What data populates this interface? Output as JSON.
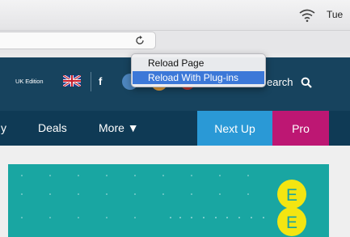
{
  "menubar": {
    "clock": "Tue"
  },
  "context_menu": {
    "items": [
      {
        "label": "Reload Page"
      },
      {
        "label": "Reload With Plug-ins"
      }
    ]
  },
  "site": {
    "header": {
      "edition": "UK Edition",
      "search_label": "earch"
    },
    "nav": {
      "items": [
        "y",
        "Deals",
        "More ▼"
      ],
      "tabs": [
        {
          "label": "Next Up"
        },
        {
          "label": "Pro"
        }
      ]
    },
    "banner_logo": "EE"
  },
  "colors": {
    "header_bg": "#17435e",
    "nav_bg": "#0f3a55",
    "next_up": "#2a99d6",
    "pro": "#bd1773",
    "banner": "#19a6a2",
    "logo_yellow": "#f3e511",
    "menu_highlight": "#3c78d8"
  },
  "icons": {
    "menubar": [
      "wifi-icon"
    ],
    "toolbar": [
      "reload-icon"
    ],
    "header": [
      "uk-flag-icon",
      "facebook-icon",
      "search-icon"
    ]
  }
}
